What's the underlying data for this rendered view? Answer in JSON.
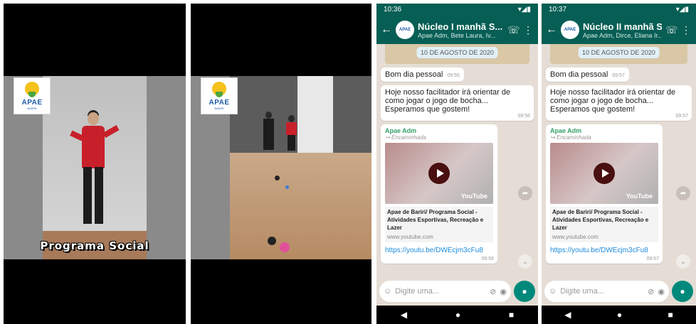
{
  "panels": [
    {
      "logo_text": "APAE",
      "logo_sub": "BARIRI",
      "caption": "Programa Social"
    },
    {
      "logo_text": "APAE",
      "logo_sub": "BARIRI"
    }
  ],
  "chats": [
    {
      "status_time": "10:36",
      "title": "Núcleo I manhã S...",
      "subtitle": "Apae Adm, Bete Laura, Iv...",
      "date": "10 DE AGOSTO DE 2020",
      "msg1": "Bom dia pessoal",
      "msg1_time": "09:55",
      "msg2": "Hoje nosso facilitador irá orientar de como jogar o jogo de bocha... Esperamos que gostem!",
      "msg2_time": "09:56",
      "sender": "Apae Adm",
      "forwarded": "Encaminhada",
      "yt_logo": "YouTube",
      "link_title": "Apae de Bariri/ Programa Social - Atividades Esportivas, Recreação e Lazer",
      "link_domain": "www.youtube.com",
      "link_url": "https://youtu.be/DWEcjm3cFu8",
      "link_time": "09:56",
      "placeholder": "Digite uma..."
    },
    {
      "status_time": "10:37",
      "title": "Núcleo II manhã S...",
      "subtitle": "Apae Adm, Dirce, Eliana Ir...",
      "date": "10 DE AGOSTO DE 2020",
      "msg1": "Bom dia pessoal",
      "msg1_time": "09:57",
      "msg2": "Hoje nosso facilitador irá orientar de como jogar o jogo de bocha... Esperamos que gostem!",
      "msg2_time": "09:57",
      "sender": "Apae Adm",
      "forwarded": "Encaminhada",
      "yt_logo": "YouTube",
      "link_title": "Apae de Bariri/ Programa Social - Atividades Esportivas, Recreação e Lazer",
      "link_domain": "www.youtube.com",
      "link_url": "https://youtu.be/DWEcjm3cFu8",
      "link_time": "09:57",
      "placeholder": "Digite uma..."
    }
  ]
}
